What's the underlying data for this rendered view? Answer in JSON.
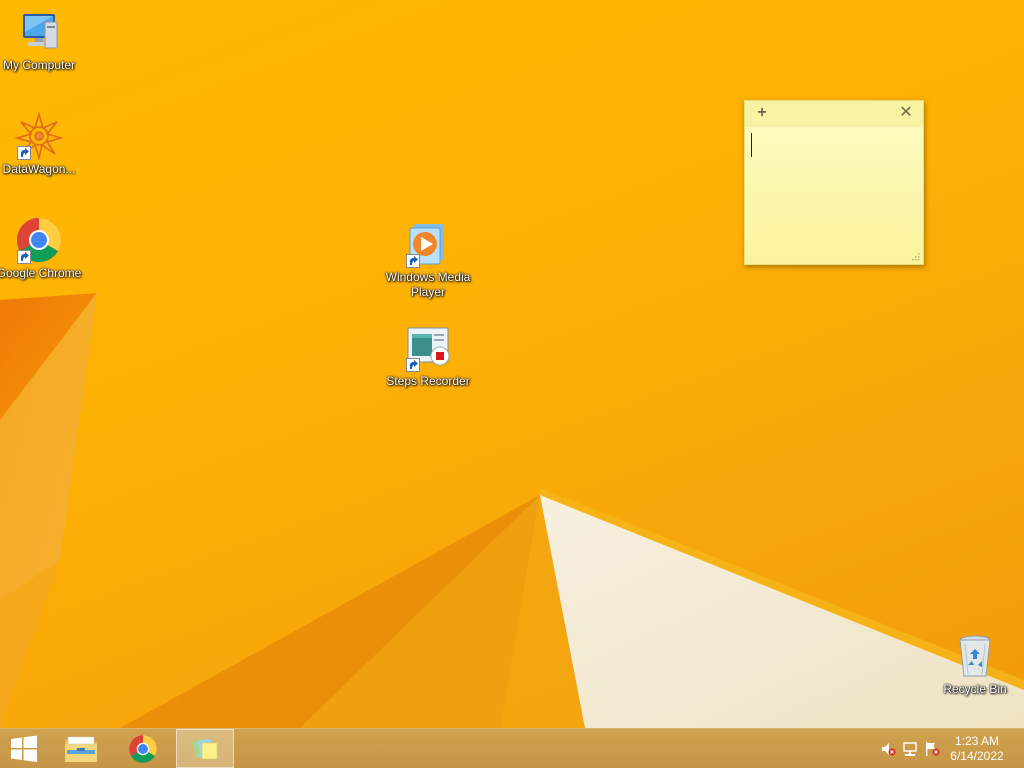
{
  "desktop": {
    "icons": [
      {
        "label": "My Computer",
        "icon": "computer-icon",
        "shortcut": false
      },
      {
        "label": "DataWagon...",
        "icon": "datawagon-icon",
        "shortcut": true
      },
      {
        "label": "Google Chrome",
        "icon": "chrome-icon",
        "shortcut": true
      },
      {
        "label": "Windows Media Player",
        "icon": "media-player-icon",
        "shortcut": true
      },
      {
        "label": "Steps Recorder",
        "icon": "steps-recorder-icon",
        "shortcut": true
      },
      {
        "label": "Recycle Bin",
        "icon": "recycle-bin-icon",
        "shortcut": false
      }
    ]
  },
  "sticky_note": {
    "add_symbol": "+",
    "close_symbol": "✕",
    "text": ""
  },
  "taskbar": {
    "buttons": [
      {
        "icon": "windows-start-icon"
      },
      {
        "icon": "file-explorer-icon"
      },
      {
        "icon": "chrome-icon"
      },
      {
        "icon": "sticky-notes-icon",
        "active": true
      }
    ],
    "tray": {
      "icons": [
        "volume-muted-icon",
        "network-icon",
        "action-center-flag-icon"
      ],
      "time": "1:23 AM",
      "date": "6/14/2022"
    }
  },
  "colors": {
    "wallpaper": "#fdb005",
    "taskbar": "#c69646",
    "sticky": "#fcf7ad"
  }
}
